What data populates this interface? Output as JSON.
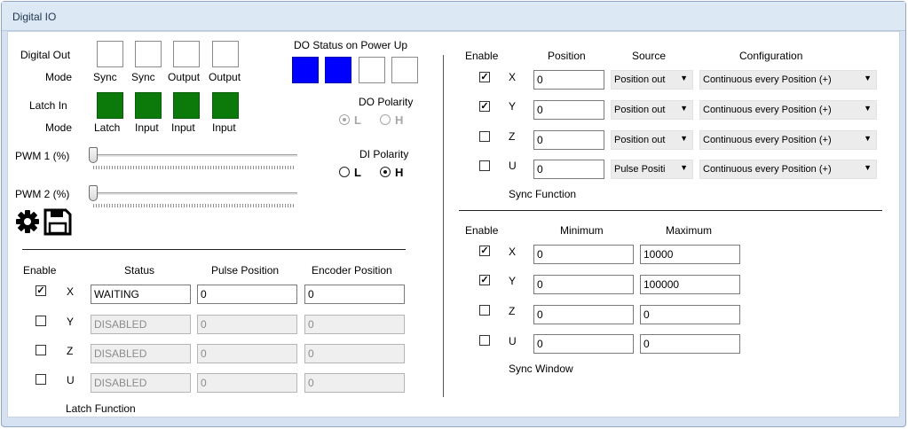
{
  "window": {
    "title": "Digital IO"
  },
  "digital_out": {
    "label": "Digital Out",
    "mode_label": "Mode",
    "modes": [
      "Sync",
      "Sync",
      "Output",
      "Output"
    ]
  },
  "latch_in": {
    "label": "Latch In",
    "mode_label": "Mode",
    "modes": [
      "Latch",
      "Input",
      "Input",
      "Input"
    ]
  },
  "do_status": {
    "label": "DO Status on Power Up",
    "states": [
      "on",
      "on",
      "off",
      "off"
    ]
  },
  "do_polarity": {
    "label": "DO Polarity",
    "low_label": "L",
    "high_label": "H",
    "selected": "L",
    "enabled": false
  },
  "di_polarity": {
    "label": "DI Polarity",
    "low_label": "L",
    "high_label": "H",
    "selected": "H",
    "enabled": true
  },
  "pwm": [
    {
      "label": "PWM 1 (%)",
      "value": 0
    },
    {
      "label": "PWM 2 (%)",
      "value": 0
    }
  ],
  "toolbar_icons": [
    "gear-icon",
    "save-icon"
  ],
  "latch_function": {
    "title": "Latch Function",
    "headers": {
      "enable": "Enable",
      "status": "Status",
      "pulse": "Pulse Position",
      "encoder": "Encoder Position"
    },
    "rows": [
      {
        "axis": "X",
        "enabled": true,
        "status": "WAITING",
        "pulse": "0",
        "encoder": "0"
      },
      {
        "axis": "Y",
        "enabled": false,
        "status": "DISABLED",
        "pulse": "0",
        "encoder": "0"
      },
      {
        "axis": "Z",
        "enabled": false,
        "status": "DISABLED",
        "pulse": "0",
        "encoder": "0"
      },
      {
        "axis": "U",
        "enabled": false,
        "status": "DISABLED",
        "pulse": "0",
        "encoder": "0"
      }
    ]
  },
  "sync_function": {
    "title": "Sync Function",
    "headers": {
      "enable": "Enable",
      "position": "Position",
      "source": "Source",
      "configuration": "Configuration"
    },
    "rows": [
      {
        "axis": "X",
        "enabled": true,
        "position": "0",
        "source": "Position out",
        "configuration": "Continuous every Position (+)"
      },
      {
        "axis": "Y",
        "enabled": true,
        "position": "0",
        "source": "Position out",
        "configuration": "Continuous every Position (+)"
      },
      {
        "axis": "Z",
        "enabled": false,
        "position": "0",
        "source": "Position out",
        "configuration": "Continuous every Position (+)"
      },
      {
        "axis": "U",
        "enabled": false,
        "position": "0",
        "source": "Pulse Positi",
        "configuration": "Continuous every Position (+)"
      }
    ]
  },
  "sync_window": {
    "title": "Sync Window",
    "headers": {
      "enable": "Enable",
      "minimum": "Minimum",
      "maximum": "Maximum"
    },
    "rows": [
      {
        "axis": "X",
        "enabled": true,
        "minimum": "0",
        "maximum": "10000"
      },
      {
        "axis": "Y",
        "enabled": true,
        "minimum": "0",
        "maximum": "100000"
      },
      {
        "axis": "Z",
        "enabled": false,
        "minimum": "0",
        "maximum": "0"
      },
      {
        "axis": "U",
        "enabled": false,
        "minimum": "0",
        "maximum": "0"
      }
    ]
  },
  "colors": {
    "latch_green": "#0b7a0b",
    "do_on_blue": "#0000ff",
    "window_frame": "#d6e2f2"
  }
}
